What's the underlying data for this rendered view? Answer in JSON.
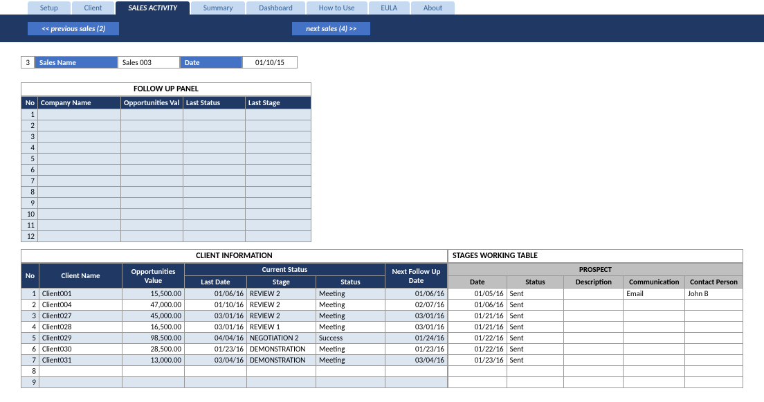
{
  "tabs": [
    "Setup",
    "Client",
    "SALES ACTIVITY",
    "Summary",
    "Dashboard",
    "How to Use",
    "EULA",
    "About"
  ],
  "activeTab": 2,
  "nav": {
    "prev": "<< previous sales (2)",
    "next": "next sales (4) >>"
  },
  "info": {
    "num": "3",
    "nameLabel": "Sales Name",
    "name": "Sales 003",
    "dateLabel": "Date",
    "date": "01/10/15"
  },
  "followup": {
    "title": "FOLLOW UP PANEL",
    "headers": [
      "No",
      "Company Name",
      "Opportunities Val",
      "Last Status",
      "Last Stage"
    ],
    "rows": [
      1,
      2,
      3,
      4,
      5,
      6,
      7,
      8,
      9,
      10,
      11,
      12
    ]
  },
  "clientInfo": {
    "title": "CLIENT INFORMATION",
    "headers": {
      "no": "No",
      "name": "Client Name",
      "opp": "Opportunities Value",
      "cs": "Current Status",
      "ld": "Last Date",
      "stg": "Stage",
      "sts": "Status",
      "nfd": "Next Follow Up Date"
    },
    "rows": [
      {
        "no": "1",
        "name": "Client001",
        "opp": "15,500.00",
        "ld": "01/06/16",
        "stg": "REVIEW 2",
        "sts": "Meeting",
        "nfd": "01/06/16"
      },
      {
        "no": "2",
        "name": "Client004",
        "opp": "47,000.00",
        "ld": "01/10/16",
        "stg": "REVIEW 2",
        "sts": "Meeting",
        "nfd": "02/07/16"
      },
      {
        "no": "3",
        "name": "Client027",
        "opp": "45,000.00",
        "ld": "03/01/16",
        "stg": "REVIEW 2",
        "sts": "Meeting",
        "nfd": "03/01/16"
      },
      {
        "no": "4",
        "name": "Client028",
        "opp": "16,500.00",
        "ld": "03/01/16",
        "stg": "REVIEW 1",
        "sts": "Meeting",
        "nfd": "03/01/16"
      },
      {
        "no": "5",
        "name": "Client029",
        "opp": "98,500.00",
        "ld": "04/04/16",
        "stg": "NEGOTIATION 2",
        "sts": "Success",
        "nfd": "01/24/16"
      },
      {
        "no": "6",
        "name": "Client030",
        "opp": "28,500.00",
        "ld": "01/23/16",
        "stg": "DEMONSTRATION",
        "sts": "Meeting",
        "nfd": "01/23/16"
      },
      {
        "no": "7",
        "name": "Client031",
        "opp": "13,000.00",
        "ld": "03/04/16",
        "stg": "DEMONSTRATION",
        "sts": "Meeting",
        "nfd": "03/04/16"
      },
      {
        "no": "8",
        "name": "",
        "opp": "",
        "ld": "",
        "stg": "",
        "sts": "",
        "nfd": ""
      },
      {
        "no": "9",
        "name": "",
        "opp": "",
        "ld": "",
        "stg": "",
        "sts": "",
        "nfd": ""
      }
    ]
  },
  "stages": {
    "title": "STAGES WORKING TABLE",
    "group": "PROSPECT",
    "headers": {
      "date": "Date",
      "status": "Status",
      "desc": "Description",
      "comm": "Communication",
      "cp": "Contact Person"
    },
    "rows": [
      {
        "date": "01/05/16",
        "status": "Sent",
        "desc": "",
        "comm": "Email",
        "cp": "John B"
      },
      {
        "date": "01/06/16",
        "status": "Sent",
        "desc": "",
        "comm": "",
        "cp": ""
      },
      {
        "date": "01/21/16",
        "status": "Sent",
        "desc": "",
        "comm": "",
        "cp": ""
      },
      {
        "date": "01/21/16",
        "status": "Sent",
        "desc": "",
        "comm": "",
        "cp": ""
      },
      {
        "date": "01/22/16",
        "status": "Sent",
        "desc": "",
        "comm": "",
        "cp": ""
      },
      {
        "date": "01/22/16",
        "status": "Sent",
        "desc": "",
        "comm": "",
        "cp": ""
      },
      {
        "date": "01/23/16",
        "status": "Sent",
        "desc": "",
        "comm": "",
        "cp": ""
      },
      {
        "date": "",
        "status": "",
        "desc": "",
        "comm": "",
        "cp": ""
      },
      {
        "date": "",
        "status": "",
        "desc": "",
        "comm": "",
        "cp": ""
      }
    ]
  }
}
